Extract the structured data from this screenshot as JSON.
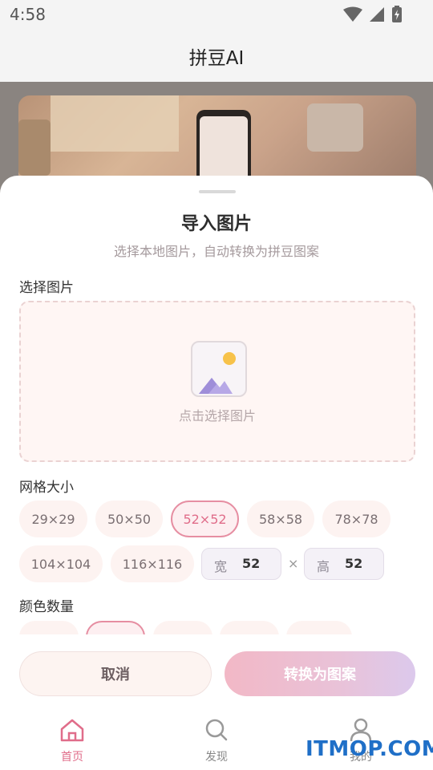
{
  "status": {
    "time": "4:58"
  },
  "app": {
    "title": "拼豆AI"
  },
  "sheet": {
    "title": "导入图片",
    "subtitle": "选择本地图片，自动转换为拼豆图案",
    "select_label": "选择图片",
    "upload_hint": "点击选择图片",
    "grid_label": "网格大小",
    "grid_options": [
      "29×29",
      "50×50",
      "52×52",
      "58×58",
      "78×78",
      "104×104",
      "116×116"
    ],
    "grid_selected": "52×52",
    "width_label": "宽",
    "width_value": "52",
    "times_symbol": "×",
    "height_label": "高",
    "height_value": "52",
    "color_label": "颜色数量",
    "cancel_label": "取消",
    "convert_label": "转换为图案"
  },
  "tabs": [
    {
      "label": "首页",
      "icon": "home-icon",
      "active": true
    },
    {
      "label": "发现",
      "icon": "search-icon",
      "active": false
    },
    {
      "label": "我的",
      "icon": "profile-icon",
      "active": false
    }
  ],
  "watermark": "ITMOP.COM",
  "colors": {
    "accent": "#e06d8a",
    "chip_bg": "#fdf3f1"
  }
}
